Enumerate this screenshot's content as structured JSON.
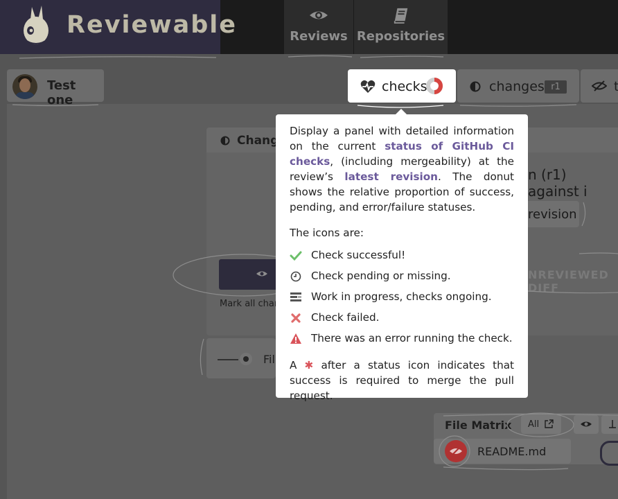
{
  "app": {
    "name": "Reviewable"
  },
  "nav": {
    "reviews": "Reviews",
    "repositories": "Repositories"
  },
  "user": {
    "name": "Test one"
  },
  "pills": {
    "checks": "checks",
    "changes": "changes",
    "changes_badge": "r1",
    "third": "t"
  },
  "background": {
    "card_title": "Change",
    "against_text": "n (r1) against i",
    "revision_button": "revision",
    "unreviewed_button": "NREVIEWED DIFF",
    "mark_all": "Mark all char",
    "file_item": "Fil"
  },
  "file_matrix": {
    "title": "File Matrix",
    "all_button": "All",
    "file_name": "README.md"
  },
  "tooltip": {
    "p1_a": "Display a panel with detailed information on the current ",
    "p1_link1": "status of GitHub CI checks",
    "p1_b": ", (including mergeability) at the review’s ",
    "p1_link2": "latest revision",
    "p1_c": ". The donut shows the relative proportion of success, pending, and error/failure statuses.",
    "icons_heading": "The icons are:",
    "items": [
      {
        "icon": "check-icon",
        "text": "Check successful!"
      },
      {
        "icon": "clock-icon",
        "text": "Check pending or missing."
      },
      {
        "icon": "progress-icon",
        "text": "Work in progress, checks ongoing."
      },
      {
        "icon": "x-icon",
        "text": "Check failed."
      },
      {
        "icon": "warning-icon",
        "text": "There was an error running the check."
      }
    ],
    "foot_a": "A",
    "foot_asterisk": "✱",
    "foot_b": "after a status icon indicates that success is required to merge the pull request."
  },
  "colors": {
    "accent_purple": "#6b5a9b",
    "success_green": "#6cbf6a",
    "error_red": "#d9535a",
    "donut_red": "#d64541",
    "brand_bg": "#2f2c40"
  }
}
